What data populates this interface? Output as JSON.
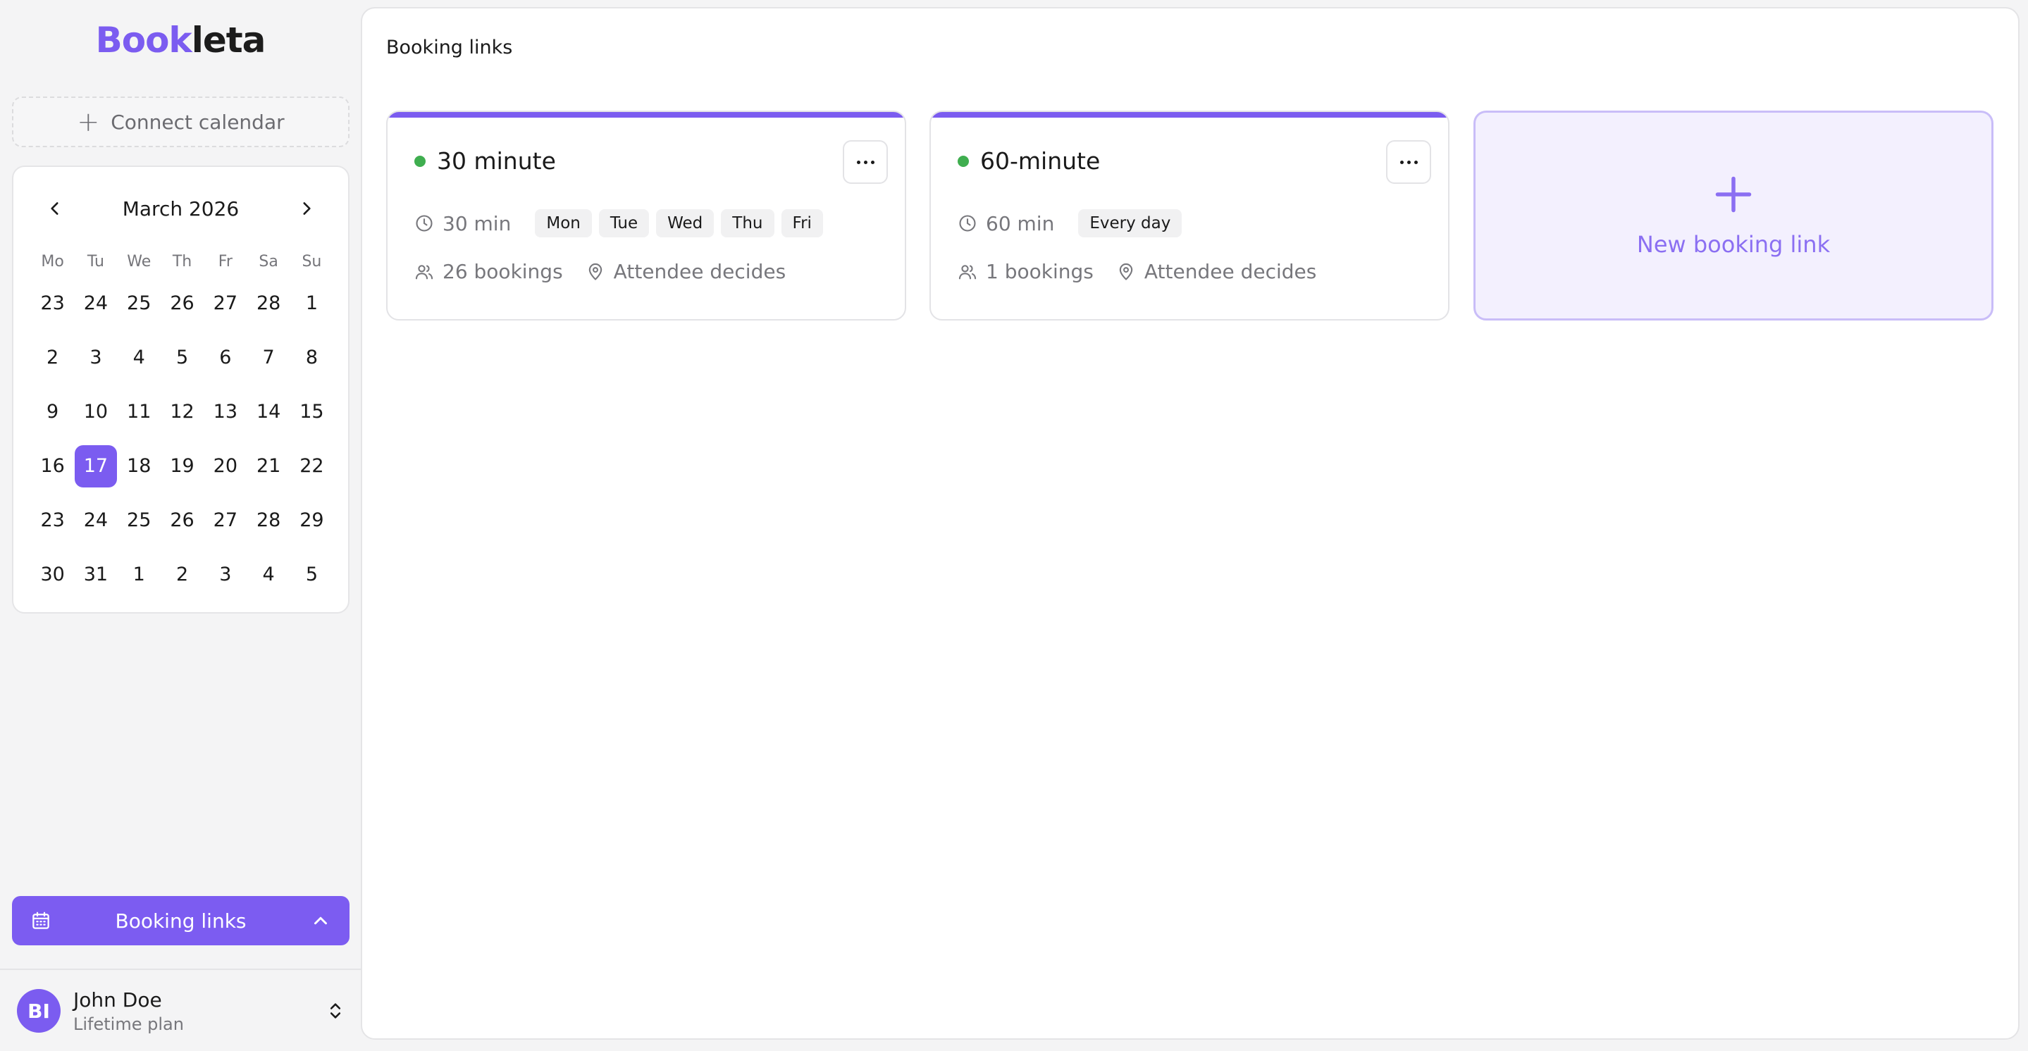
{
  "app": {
    "logo_part1": "Book",
    "logo_part2": "leta",
    "accent_color": "#7b5cf0"
  },
  "sidebar": {
    "connect_calendar_label": "Connect calendar",
    "calendar": {
      "month_label": "March 2026",
      "weekdays": [
        "Mo",
        "Tu",
        "We",
        "Th",
        "Fr",
        "Sa",
        "Su"
      ],
      "days": [
        "23",
        "24",
        "25",
        "26",
        "27",
        "28",
        "1",
        "2",
        "3",
        "4",
        "5",
        "6",
        "7",
        "8",
        "9",
        "10",
        "11",
        "12",
        "13",
        "14",
        "15",
        "16",
        "17",
        "18",
        "19",
        "20",
        "21",
        "22",
        "23",
        "24",
        "25",
        "26",
        "27",
        "28",
        "29",
        "30",
        "31",
        "1",
        "2",
        "3",
        "4",
        "5"
      ],
      "selected_day": "17"
    },
    "nav_booking_label": "Booking links",
    "user": {
      "initials": "BI",
      "name": "John Doe",
      "plan": "Lifetime plan"
    }
  },
  "main": {
    "page_title": "Booking links",
    "cards": [
      {
        "title": "30 minute",
        "duration": "30 min",
        "days": [
          "Mon",
          "Tue",
          "Wed",
          "Thu",
          "Fri"
        ],
        "bookings": "26 bookings",
        "location": "Attendee decides",
        "status_color": "#3fae4f"
      },
      {
        "title": "60-minute",
        "duration": "60 min",
        "days": [
          "Every day"
        ],
        "bookings": "1 bookings",
        "location": "Attendee decides",
        "status_color": "#3fae4f"
      }
    ],
    "new_link_label": "New booking link"
  }
}
